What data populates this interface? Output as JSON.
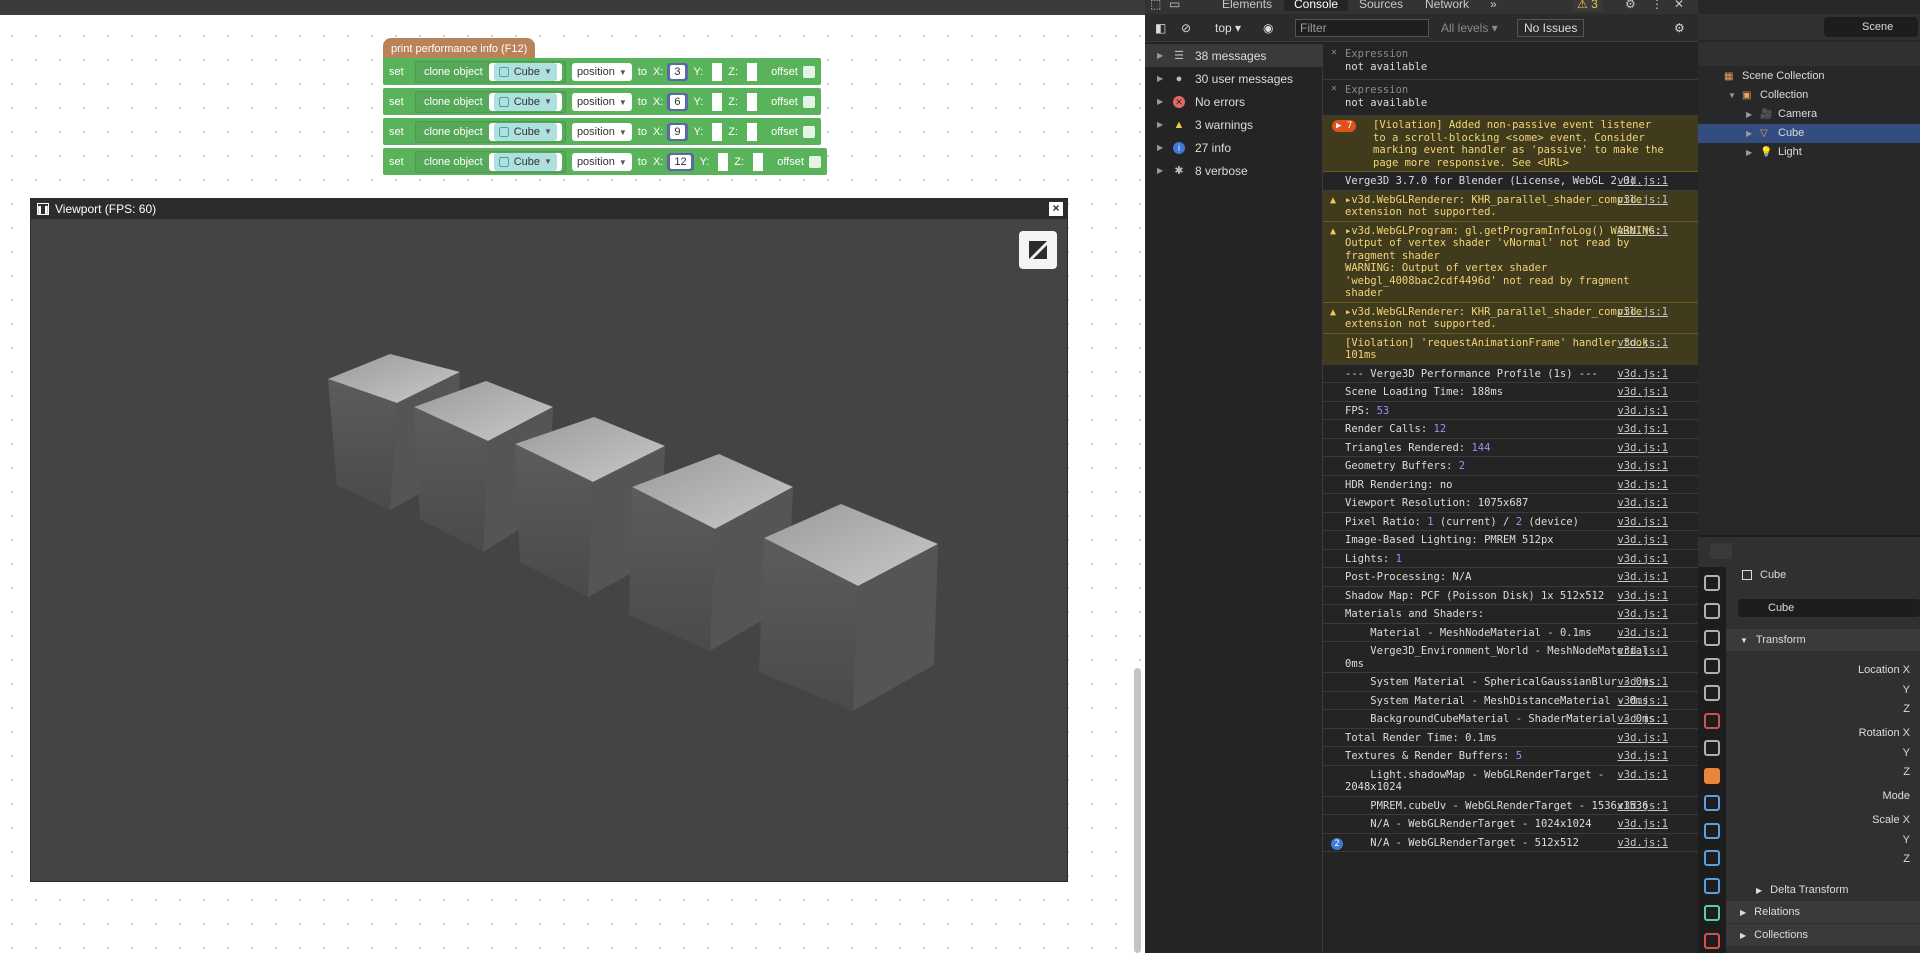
{
  "puzzles": {
    "hat_block_label": "print performance info (F12)",
    "set_blocks": [
      {
        "kw": "set",
        "action": "clone object",
        "object": "Cube",
        "property": "position",
        "to": "to",
        "x_label": "X:",
        "x": "3",
        "y_label": "Y:",
        "z_label": "Z:",
        "offset": "offset"
      },
      {
        "kw": "set",
        "action": "clone object",
        "object": "Cube",
        "property": "position",
        "to": "to",
        "x_label": "X:",
        "x": "6",
        "y_label": "Y:",
        "z_label": "Z:",
        "offset": "offset"
      },
      {
        "kw": "set",
        "action": "clone object",
        "object": "Cube",
        "property": "position",
        "to": "to",
        "x_label": "X:",
        "x": "9",
        "y_label": "Y:",
        "z_label": "Z:",
        "offset": "offset"
      },
      {
        "kw": "set",
        "action": "clone object",
        "object": "Cube",
        "property": "position",
        "to": "to",
        "x_label": "X:",
        "x": "12",
        "y_label": "Y:",
        "z_label": "Z:",
        "offset": "offset"
      }
    ]
  },
  "viewport": {
    "title": "Viewport (FPS: 60)",
    "close_label": "×"
  },
  "devtools": {
    "tabs": [
      "Elements",
      "Console",
      "Sources",
      "Network"
    ],
    "active_tab": "Console",
    "warning_count": "3",
    "context": "top",
    "filter_placeholder": "Filter",
    "levels": "All levels",
    "issues": "No Issues",
    "sidebar": [
      {
        "label": "38 messages",
        "icon": "list-icon"
      },
      {
        "label": "30 user messages",
        "icon": "user-icon"
      },
      {
        "label": "No errors",
        "icon": "error-icon"
      },
      {
        "label": "3 warnings",
        "icon": "warning-icon"
      },
      {
        "label": "27 info",
        "icon": "info-icon"
      },
      {
        "label": "8 verbose",
        "icon": "verbose-icon"
      }
    ],
    "expressions": [
      {
        "label": "Expression",
        "value": "not available"
      },
      {
        "label": "Expression",
        "value": "not available"
      }
    ],
    "violation_count": "7",
    "violation_text": "[Violation] Added non-passive event listener to a scroll-blocking <some> event. Consider marking event handler as 'passive' to make the page more responsive. See <URL>",
    "source_link": "v3d.js:1",
    "log": [
      {
        "text": "Verge3D 3.7.0 for Blender (License, WebGL 2.0)",
        "type": "log"
      },
      {
        "text": "▸v3d.WebGLRenderer: KHR_parallel_shader_compile extension not supported.",
        "type": "warn"
      },
      {
        "text": "▸v3d.WebGLProgram: gl.getProgramInfoLog() WARNING: Output of vertex shader 'vNormal' not read by fragment shader\nWARNING: Output of vertex shader 'webgl_4008bac2cdf4496d' not read by fragment shader",
        "type": "warn"
      },
      {
        "text": "▸v3d.WebGLRenderer: KHR_parallel_shader_compile extension not supported.",
        "type": "warn"
      },
      {
        "text": "[Violation] 'requestAnimationFrame' handler took 101ms",
        "type": "violation"
      },
      {
        "text": "--- Verge3D Performance Profile (1s) ---",
        "type": "log"
      },
      {
        "text": "Scene Loading Time: 188ms",
        "type": "log"
      },
      {
        "text": "FPS: ",
        "num": "53",
        "type": "log"
      },
      {
        "text": "Render Calls: ",
        "num": "12",
        "type": "log"
      },
      {
        "text": "Triangles Rendered: ",
        "num": "144",
        "type": "log"
      },
      {
        "text": "Geometry Buffers: ",
        "num": "2",
        "type": "log"
      },
      {
        "text": "HDR Rendering: no",
        "type": "log"
      },
      {
        "text": "Viewport Resolution: 1075x687",
        "type": "log"
      },
      {
        "text": "Pixel Ratio: ",
        "num": "1",
        "rest": " (current) / ",
        "num2": "2",
        "rest2": " (device)",
        "type": "log"
      },
      {
        "text": "Image-Based Lighting: PMREM 512px",
        "type": "log"
      },
      {
        "text": "Lights: ",
        "num": "1",
        "type": "log"
      },
      {
        "text": "Post-Processing: N/A",
        "type": "log"
      },
      {
        "text": "Shadow Map: PCF (Poisson Disk) 1x 512x512",
        "type": "log"
      },
      {
        "text": "Materials and Shaders:",
        "type": "log"
      },
      {
        "text": "    Material - MeshNodeMaterial - 0.1ms",
        "type": "log"
      },
      {
        "text": "    Verge3D_Environment_World - MeshNodeMaterial - 0ms",
        "type": "log"
      },
      {
        "text": "    System Material - SphericalGaussianBlur - 0ms",
        "type": "log"
      },
      {
        "text": "    System Material - MeshDistanceMaterial - 0ms",
        "type": "log"
      },
      {
        "text": "    BackgroundCubeMaterial - ShaderMaterial - 0ms",
        "type": "log"
      },
      {
        "text": "Total Render Time: 0.1ms",
        "type": "log"
      },
      {
        "text": "Textures & Render Buffers: ",
        "num": "5",
        "type": "log"
      },
      {
        "text": "    Light.shadowMap - WebGLRenderTarget - 2048x1024",
        "type": "log"
      },
      {
        "text": "    PMREM.cubeUv - WebGLRenderTarget - 1536x1536",
        "type": "log"
      },
      {
        "text": "    N/A - WebGLRenderTarget - 1024x1024",
        "type": "log"
      },
      {
        "text": "    N/A - WebGLRenderTarget - 512x512",
        "type": "log",
        "badge": "2"
      }
    ]
  },
  "blender": {
    "scene_name": "Scene",
    "outliner": [
      {
        "label": "Scene Collection",
        "indent": 0
      },
      {
        "label": "Collection",
        "indent": 1
      },
      {
        "label": "Camera",
        "indent": 2
      },
      {
        "label": "Cube",
        "indent": 2,
        "selected": true
      },
      {
        "label": "Light",
        "indent": 2
      }
    ],
    "props": {
      "object_name": "Cube",
      "object_field": "Cube",
      "panels": [
        "Transform",
        "Delta Transform",
        "Relations",
        "Collections"
      ],
      "labels": [
        "Location X",
        "Y",
        "Z",
        "Rotation X",
        "Y",
        "Z",
        "Mode",
        "Scale X",
        "Y",
        "Z"
      ]
    }
  }
}
